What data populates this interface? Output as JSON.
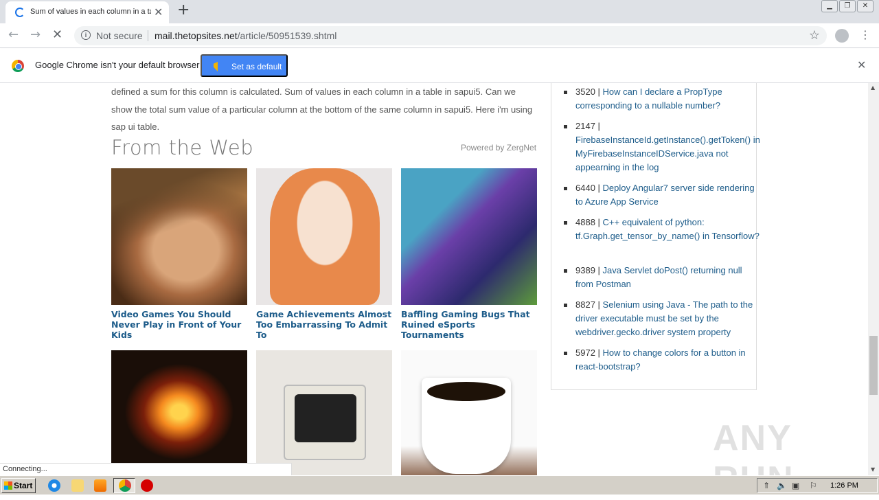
{
  "browser": {
    "tab_title": "Sum of values in each column in a ta",
    "address": {
      "security_label": "Not secure",
      "host": "mail.thetopsites.net",
      "path": "/article/50951539.shtml"
    }
  },
  "infobar": {
    "message": "Google Chrome isn't your default browser",
    "button_label": "Set as default"
  },
  "article": {
    "text": "defined a sum for this column is calculated. Sum of values in each column in a table in sapui5. Can we show the total sum value of a particular column at the bottom of the same column in sapui5. Here i'm using sap ui table.",
    "from_web_heading": "From the Web",
    "powered_by": "Powered by ZergNet",
    "cards": [
      {
        "title": "Video Games You Should Never Play in Front of Your Kids"
      },
      {
        "title": "Game Achievements Almost Too Embarrassing To Admit To"
      },
      {
        "title": "Baffling Gaming Bugs That Ruined eSports Tournaments"
      },
      {
        "title": ""
      },
      {
        "title": ""
      },
      {
        "title": ""
      }
    ]
  },
  "sidebar": {
    "items": [
      {
        "count": "3520 | ",
        "link": "How can I declare a PropType corresponding to a nullable number?"
      },
      {
        "count": "2147 | ",
        "link": "FirebaseInstanceId.getInstance().getToken() in MyFirebaseInstanceIDService.java not appearning in the log"
      },
      {
        "count": "6440 | ",
        "link": "Deploy Angular7 server side rendering to Azure App Service"
      },
      {
        "count": "4888 | ",
        "link": "C++ equivalent of python: tf.Graph.get_tensor_by_name() in Tensorflow?"
      },
      {
        "count": "9389 | ",
        "link": "Java Servlet doPost() returning null from Postman"
      },
      {
        "count": "8827 | ",
        "link": "Selenium using Java - The path to the driver executable must be set by the webdriver.gecko.driver system property"
      },
      {
        "count": "5972 | ",
        "link": "How to change colors for a button in react-bootstrap?"
      }
    ]
  },
  "status_bar": "Connecting...",
  "watermark": "ANY RUN",
  "taskbar": {
    "start_label": "Start",
    "clock": "1:26 PM"
  },
  "colors": {
    "link": "#1d5c8a",
    "set_default_button": "#4285f4"
  }
}
